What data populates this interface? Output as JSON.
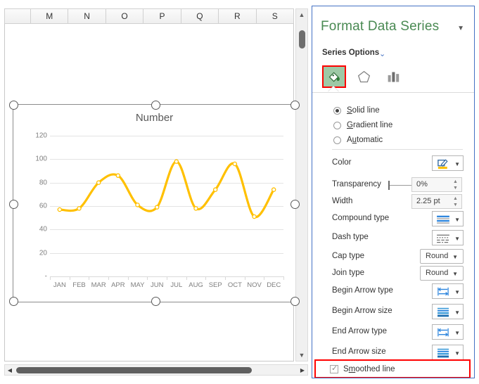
{
  "sheet": {
    "column_headers": [
      "M",
      "N",
      "O",
      "P",
      "Q",
      "R",
      "S"
    ],
    "vscroll": {
      "up_icon": "triangle-up",
      "down_icon": "triangle-down"
    },
    "hscroll": {
      "left_icon": "triangle-left",
      "right_icon": "triangle-right"
    }
  },
  "chart_data": {
    "type": "line",
    "title": "Number",
    "xlabel": "",
    "ylabel": "",
    "categories": [
      "JAN",
      "FEB",
      "MAR",
      "APR",
      "MAY",
      "JUN",
      "JUL",
      "AUG",
      "SEP",
      "OCT",
      "NOV",
      "DEC"
    ],
    "values": [
      57,
      58,
      80,
      86,
      61,
      59,
      98,
      58,
      74,
      96,
      51,
      74
    ],
    "series": [
      {
        "name": "Number",
        "values": [
          57,
          58,
          80,
          86,
          61,
          59,
          98,
          58,
          74,
          96,
          51,
          74
        ]
      }
    ],
    "ytick_labels": [
      "120",
      "100",
      "80",
      "60",
      "40",
      "20",
      "-"
    ],
    "ytick_values": [
      120,
      100,
      80,
      60,
      40,
      20,
      0
    ],
    "ylim": [
      0,
      120
    ],
    "grid": true,
    "legend": "none",
    "smoothed": true,
    "line_color": "#FFC000",
    "marker": "open-circle",
    "marker_fill": "#FFFFFF"
  },
  "pane": {
    "title": "Format Data Series",
    "close_caret": "chevron-down-icon",
    "section": "Series Options",
    "section_chevron": "chevron-down-icon",
    "tabs": [
      {
        "name": "fill-line",
        "icon": "paint-bucket-icon",
        "selected": true
      },
      {
        "name": "effects",
        "icon": "pentagon-icon",
        "selected": false
      },
      {
        "name": "series-options",
        "icon": "bar-chart-icon",
        "selected": false
      }
    ],
    "line_type": {
      "options": [
        {
          "label": "Solid line",
          "selected": true
        },
        {
          "label": "Gradient line",
          "selected": false
        },
        {
          "label": "Automatic",
          "selected": false
        }
      ]
    },
    "rows": [
      {
        "label": "Color",
        "control": "gallery",
        "icon": "pen-color-icon",
        "value": ""
      },
      {
        "label": "Transparency",
        "control": "spinner",
        "icon": "",
        "value": "0%"
      },
      {
        "label": "Width",
        "control": "spinner",
        "icon": "",
        "value": "2.25 pt"
      },
      {
        "label": "Compound type",
        "control": "gallery",
        "icon": "compound-line-icon",
        "value": ""
      },
      {
        "label": "Dash type",
        "control": "gallery",
        "icon": "dash-line-icon",
        "value": ""
      },
      {
        "label": "Cap type",
        "control": "combo",
        "icon": "",
        "value": "Round"
      },
      {
        "label": "Join type",
        "control": "combo",
        "icon": "",
        "value": "Round"
      },
      {
        "label": "Begin Arrow type",
        "control": "gallery",
        "icon": "arrow-type-icon",
        "value": ""
      },
      {
        "label": "Begin Arrow size",
        "control": "gallery",
        "icon": "arrow-size-icon",
        "value": ""
      },
      {
        "label": "End Arrow type",
        "control": "gallery",
        "icon": "arrow-type-icon",
        "value": ""
      },
      {
        "label": "End Arrow size",
        "control": "gallery",
        "icon": "arrow-size-icon",
        "value": ""
      }
    ],
    "smoothed_line": {
      "label": "Smoothed line",
      "checked": true
    },
    "accent_color": "#4472c4",
    "title_color": "#4a8a53",
    "highlight_color": "#ff0000"
  }
}
